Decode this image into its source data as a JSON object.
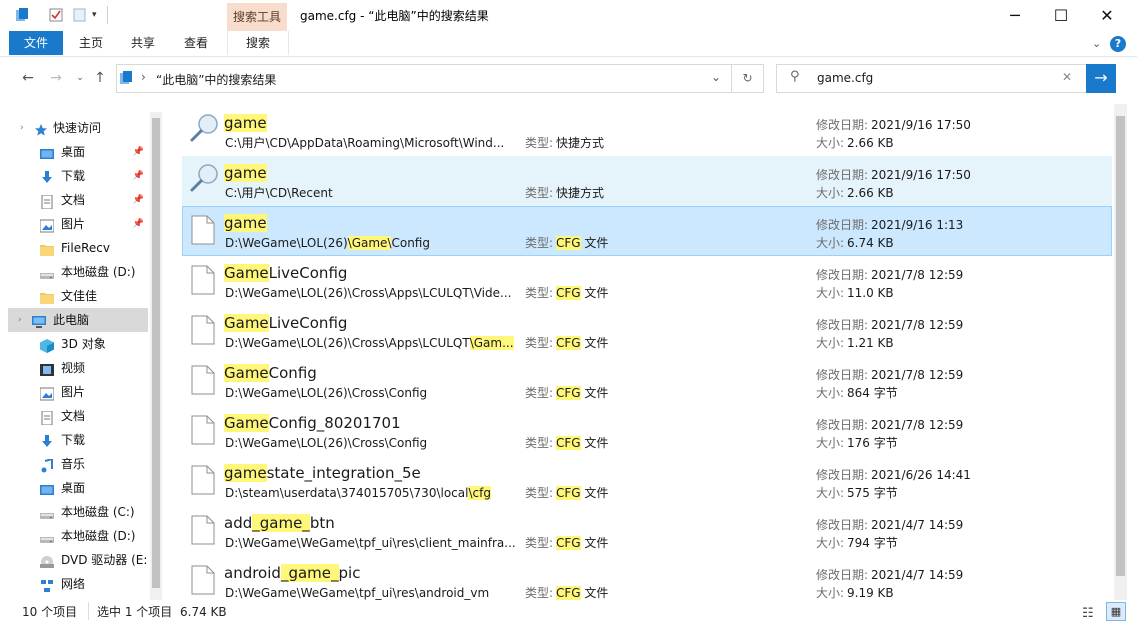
{
  "window": {
    "title": "game.cfg - “此电脑”中的搜索结果",
    "context_tab_group": "搜索工具"
  },
  "ribbon": {
    "tabs": [
      "文件",
      "主页",
      "共享",
      "查看",
      "搜索"
    ]
  },
  "address": {
    "breadcrumb": "“此电脑”中的搜索结果"
  },
  "search": {
    "value": "game.cfg"
  },
  "nav": {
    "items": [
      {
        "label": "快速访问",
        "icon": "star-icon"
      },
      {
        "label": "桌面",
        "icon": "desktop-icon",
        "pinned": true
      },
      {
        "label": "下载",
        "icon": "download-icon",
        "pinned": true
      },
      {
        "label": "文档",
        "icon": "document-icon",
        "pinned": true
      },
      {
        "label": "图片",
        "icon": "picture-icon",
        "pinned": true
      },
      {
        "label": "FileRecv",
        "icon": "folder-icon"
      },
      {
        "label": "本地磁盘 (D:)",
        "icon": "drive-icon"
      },
      {
        "label": "文佳佳",
        "icon": "folder-icon"
      },
      {
        "label": "此电脑",
        "icon": "computer-icon"
      },
      {
        "label": "3D 对象",
        "icon": "cube-icon"
      },
      {
        "label": "视频",
        "icon": "video-icon"
      },
      {
        "label": "图片",
        "icon": "picture-icon"
      },
      {
        "label": "文档",
        "icon": "document-icon"
      },
      {
        "label": "下载",
        "icon": "download-icon"
      },
      {
        "label": "音乐",
        "icon": "music-icon"
      },
      {
        "label": "桌面",
        "icon": "desktop-icon"
      },
      {
        "label": "本地磁盘 (C:)",
        "icon": "drive-icon"
      },
      {
        "label": "本地磁盘 (D:)",
        "icon": "drive-icon"
      },
      {
        "label": "DVD 驱动器 (E:)",
        "icon": "dvd-icon"
      },
      {
        "label": "网络",
        "icon": "network-icon"
      }
    ]
  },
  "labels": {
    "type": "类型:",
    "modified": "修改日期:",
    "size": "大小:"
  },
  "results": [
    {
      "icon": "search-shortcut-icon",
      "name_pre": "",
      "name_hl": "game",
      "name_post": "",
      "path_pre": "C:\\用户\\CD\\AppData\\Roaming\\Microsoft\\Wind...",
      "path_hl": "",
      "path_post": "",
      "type_hl": "",
      "type_rest": "快捷方式",
      "date": "2021/9/16 17:50",
      "size": "2.66 KB"
    },
    {
      "icon": "search-shortcut-icon",
      "name_pre": "",
      "name_hl": "game",
      "name_post": "",
      "path_pre": "C:\\用户\\CD\\Recent",
      "path_hl": "",
      "path_post": "",
      "type_hl": "",
      "type_rest": "快捷方式",
      "date": "2021/9/16 17:50",
      "size": "2.66 KB"
    },
    {
      "icon": "file-icon",
      "name_pre": "",
      "name_hl": "game",
      "name_post": "",
      "path_pre": "D:\\WeGame\\LOL(26)",
      "path_hl": "\\Game\\",
      "path_post": "Config",
      "type_hl": "CFG",
      "type_rest": " 文件",
      "date": "2021/9/16 1:13",
      "size": "6.74 KB"
    },
    {
      "icon": "file-icon",
      "name_pre": "",
      "name_hl": "Game",
      "name_post": "LiveConfig",
      "path_pre": "D:\\WeGame\\LOL(26)\\Cross\\Apps\\LCULQT\\Vide...",
      "path_hl": "",
      "path_post": "",
      "type_hl": "CFG",
      "type_rest": " 文件",
      "date": "2021/7/8 12:59",
      "size": "11.0 KB"
    },
    {
      "icon": "file-icon",
      "name_pre": "",
      "name_hl": "Game",
      "name_post": "LiveConfig",
      "path_pre": "D:\\WeGame\\LOL(26)\\Cross\\Apps\\LCULQT",
      "path_hl": "\\Gam...",
      "path_post": "",
      "type_hl": "CFG",
      "type_rest": " 文件",
      "date": "2021/7/8 12:59",
      "size": "1.21 KB"
    },
    {
      "icon": "file-icon",
      "name_pre": "",
      "name_hl": "Game",
      "name_post": "Config",
      "path_pre": "D:\\WeGame\\LOL(26)\\Cross\\Config",
      "path_hl": "",
      "path_post": "",
      "type_hl": "CFG",
      "type_rest": " 文件",
      "date": "2021/7/8 12:59",
      "size": "864 字节"
    },
    {
      "icon": "file-icon",
      "name_pre": "",
      "name_hl": "Game",
      "name_post": "Config_80201701",
      "path_pre": "D:\\WeGame\\LOL(26)\\Cross\\Config",
      "path_hl": "",
      "path_post": "",
      "type_hl": "CFG",
      "type_rest": " 文件",
      "date": "2021/7/8 12:59",
      "size": "176 字节"
    },
    {
      "icon": "file-icon",
      "name_pre": "",
      "name_hl": "game",
      "name_post": "state_integration_5e",
      "path_pre": "D:\\steam\\userdata\\374015705\\730\\local",
      "path_hl": "\\cfg",
      "path_post": "",
      "type_hl": "CFG",
      "type_rest": " 文件",
      "date": "2021/6/26 14:41",
      "size": "575 字节"
    },
    {
      "icon": "file-icon",
      "name_pre": "add",
      "name_hl": "_game_",
      "name_post": "btn",
      "path_pre": "D:\\WeGame\\WeGame\\tpf_ui\\res\\client_mainfra...",
      "path_hl": "",
      "path_post": "",
      "type_hl": "CFG",
      "type_rest": " 文件",
      "date": "2021/4/7 14:59",
      "size": "794 字节"
    },
    {
      "icon": "file-icon",
      "name_pre": "android",
      "name_hl": "_game_",
      "name_post": "pic",
      "path_pre": "D:\\WeGame\\WeGame\\tpf_ui\\res\\android_vm",
      "path_hl": "",
      "path_post": "",
      "type_hl": "CFG",
      "type_rest": " 文件",
      "date": "2021/4/7 14:59",
      "size": "9.19 KB"
    }
  ],
  "status": {
    "count": "10 个项目",
    "selection": "选中 1 个项目",
    "selection_size": "6.74 KB"
  },
  "colors": {
    "accent": "#1979ca",
    "selected_row": "#cce8ff",
    "hover_row": "#e5f3fb",
    "highlight": "#fff77a",
    "context_tab": "#f8ddcc"
  }
}
